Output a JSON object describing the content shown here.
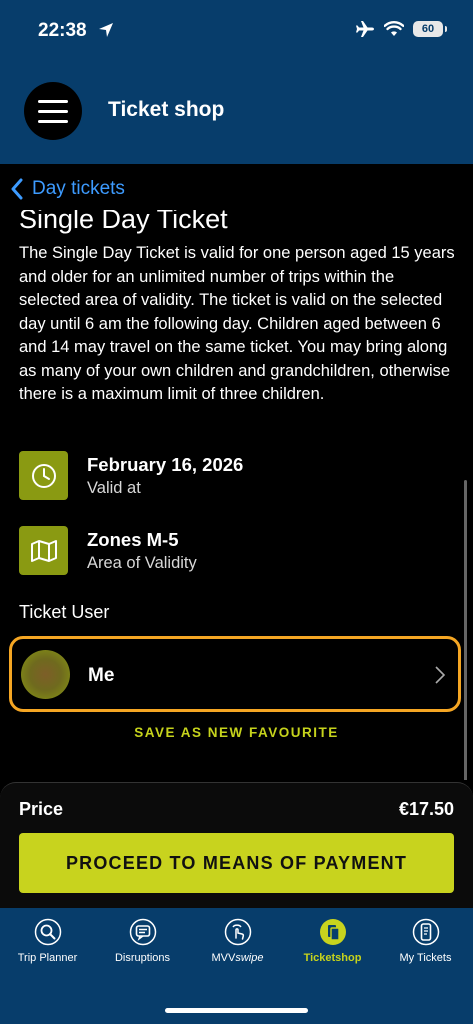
{
  "status_bar": {
    "time": "22:38",
    "battery": "60"
  },
  "header": {
    "title": "Ticket shop"
  },
  "nav": {
    "back_label": "Day tickets"
  },
  "product": {
    "title": "Single Day Ticket",
    "description": "The Single Day Ticket is valid for one person aged 15 years and older for an unlimited number of trips within the selected area of validity. The ticket is valid on the selected day until 6 am the following day. Children aged between 6 and 14 may travel on the same ticket. You may bring along as many of your own children and grandchildren, otherwise there is a maximum limit of three children."
  },
  "validity": {
    "date": "February 16, 2026",
    "date_label": "Valid at",
    "zones": "Zones M-5",
    "zones_label": "Area of Validity"
  },
  "ticket_user": {
    "section_label": "Ticket User",
    "name": "Me"
  },
  "favourite_label": "SAVE AS NEW FAVOURITE",
  "price": {
    "label": "Price",
    "value": "€17.50"
  },
  "pay_button": "PROCEED TO MEANS OF PAYMENT",
  "tabs": [
    {
      "label": "Trip Planner",
      "icon": "search-icon"
    },
    {
      "label": "Disruptions",
      "icon": "disruptions-icon"
    },
    {
      "label_main": "MVV",
      "label_em": "swipe",
      "icon": "swipe-icon"
    },
    {
      "label": "Ticketshop",
      "icon": "ticketshop-icon",
      "active": true
    },
    {
      "label": "My Tickets",
      "icon": "phone-ticket-icon"
    }
  ],
  "colors": {
    "header": "#073d6b",
    "accent": "#c8d31e",
    "link": "#3d9bff",
    "highlight": "#f5a623",
    "icon_bg": "#8a9a12"
  }
}
